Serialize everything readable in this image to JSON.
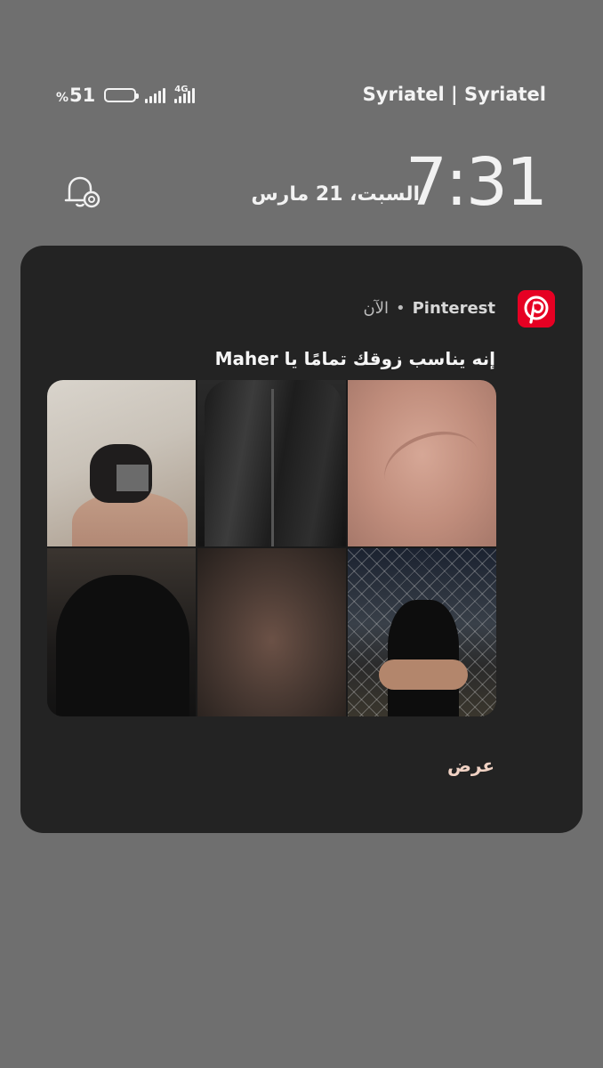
{
  "status_bar": {
    "battery_level": "51",
    "battery_symbol": "%",
    "battery_fraction": 0.51,
    "network_type": "4G",
    "carrier": "Syriatel | Syriatel"
  },
  "lockscreen": {
    "time": "7:31",
    "date": "السبت، 21 مارس"
  },
  "notification": {
    "app_name": "Pinterest",
    "separator": "•",
    "timestamp": "الآن",
    "title": "إنه يناسب زوقك تمامًا يا Maher",
    "images": [
      "pin-image-1",
      "pin-image-2",
      "pin-image-3",
      "pin-image-4",
      "pin-image-5",
      "pin-image-6"
    ],
    "action_label": "عرض"
  },
  "colors": {
    "background": "#6f6f6f",
    "card": "#232323",
    "brand": "#e60023",
    "action_text": "#f0d2c4"
  },
  "icons": {
    "alarm": "alarm-bell-gear-icon",
    "battery": "battery-icon",
    "signal": "signal-bars-icon",
    "app": "pinterest-logo-icon"
  }
}
